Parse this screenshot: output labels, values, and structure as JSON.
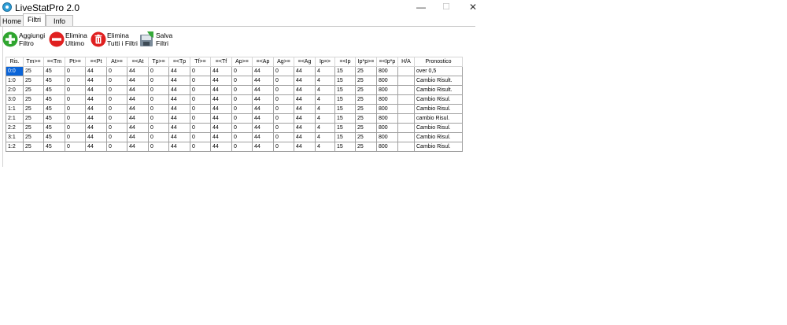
{
  "window": {
    "title": "LiveStatPro 2.0",
    "minimize": "—",
    "maximize": "☐",
    "close": "✕"
  },
  "tabs": [
    {
      "label": "Home"
    },
    {
      "label": "Filtri"
    },
    {
      "label": "Info"
    }
  ],
  "toolbar": {
    "add": {
      "line1": "Aggiungi",
      "line2": "Filtro"
    },
    "delete_last": {
      "line1": "Elimina",
      "line2": "Ultimo"
    },
    "delete_all": {
      "line1": "Elimina",
      "line2": "Tutti i Filtri"
    },
    "save": {
      "line1": "Salva",
      "line2": "Filtri"
    }
  },
  "colors": {
    "add": "#2fa52f",
    "delete": "#e02020",
    "selection": "#0a64d8"
  },
  "table": {
    "headers": [
      "Ris.",
      "Tm>=",
      "=<Tm",
      "Pt>=",
      "=<Pt",
      "At>=",
      "=<At",
      "Tp>=",
      "=<Tp",
      "Tf>=",
      "=<Tf",
      "Ap>=",
      "=<Ap",
      "Ag>=",
      "=<Ag",
      "Ip=>",
      "=<Ip",
      "Ip*p>=",
      "=<Ip*p",
      "H/A",
      "Pronostico"
    ],
    "rows": [
      [
        "0:0",
        "25",
        "45",
        "0",
        "44",
        "0",
        "44",
        "0",
        "44",
        "0",
        "44",
        "0",
        "44",
        "0",
        "44",
        "4",
        "15",
        "25",
        "800",
        "",
        "over 0,5"
      ],
      [
        "1:0",
        "25",
        "45",
        "0",
        "44",
        "0",
        "44",
        "0",
        "44",
        "0",
        "44",
        "0",
        "44",
        "0",
        "44",
        "4",
        "15",
        "25",
        "800",
        "",
        "Cambio Risult."
      ],
      [
        "2:0",
        "25",
        "45",
        "0",
        "44",
        "0",
        "44",
        "0",
        "44",
        "0",
        "44",
        "0",
        "44",
        "0",
        "44",
        "4",
        "15",
        "25",
        "800",
        "",
        "Cambio Risult."
      ],
      [
        "3:0",
        "25",
        "45",
        "0",
        "44",
        "0",
        "44",
        "0",
        "44",
        "0",
        "44",
        "0",
        "44",
        "0",
        "44",
        "4",
        "15",
        "25",
        "800",
        "",
        "Cambio Risul."
      ],
      [
        "1:1",
        "25",
        "45",
        "0",
        "44",
        "0",
        "44",
        "0",
        "44",
        "0",
        "44",
        "0",
        "44",
        "0",
        "44",
        "4",
        "15",
        "25",
        "800",
        "",
        "Cambio Risul."
      ],
      [
        "2:1",
        "25",
        "45",
        "0",
        "44",
        "0",
        "44",
        "0",
        "44",
        "0",
        "44",
        "0",
        "44",
        "0",
        "44",
        "4",
        "15",
        "25",
        "800",
        "",
        "cambio Risul."
      ],
      [
        "2:2",
        "25",
        "45",
        "0",
        "44",
        "0",
        "44",
        "0",
        "44",
        "0",
        "44",
        "0",
        "44",
        "0",
        "44",
        "4",
        "15",
        "25",
        "800",
        "",
        "Cambio Risul."
      ],
      [
        "3:1",
        "25",
        "45",
        "0",
        "44",
        "0",
        "44",
        "0",
        "44",
        "0",
        "44",
        "0",
        "44",
        "0",
        "44",
        "4",
        "15",
        "25",
        "800",
        "",
        "Cambio Risul."
      ],
      [
        "1:2",
        "25",
        "45",
        "0",
        "44",
        "0",
        "44",
        "0",
        "44",
        "0",
        "44",
        "0",
        "44",
        "0",
        "44",
        "4",
        "15",
        "25",
        "800",
        "",
        "Cambio Risul."
      ]
    ]
  }
}
